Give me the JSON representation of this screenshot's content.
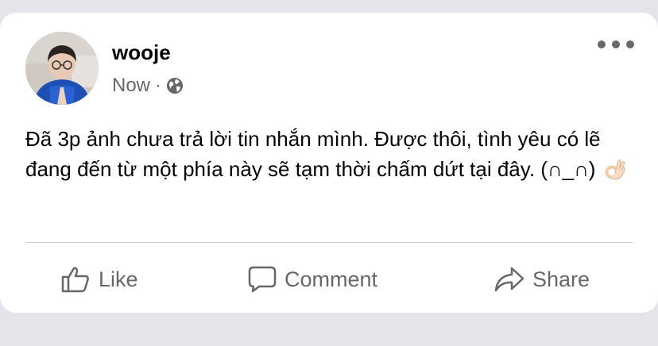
{
  "post": {
    "author": "wooje",
    "time": "Now",
    "separator": "·",
    "privacy_icon": "globe-icon",
    "text": "Đã 3p ảnh chưa trả lời tin nhắn mình. Được thôi, tình yêu có lẽ đang đến từ một phía này sẽ tạm thời chấm dứt tại đây. (∩_∩)",
    "emoji": "ok-hand-emoji"
  },
  "actions": {
    "like_label": "Like",
    "comment_label": "Comment",
    "share_label": "Share"
  },
  "colors": {
    "background": "#e4e5ea",
    "card": "#ffffff",
    "text": "#050505",
    "secondary_text": "#65676b",
    "divider": "#c8cacf"
  }
}
